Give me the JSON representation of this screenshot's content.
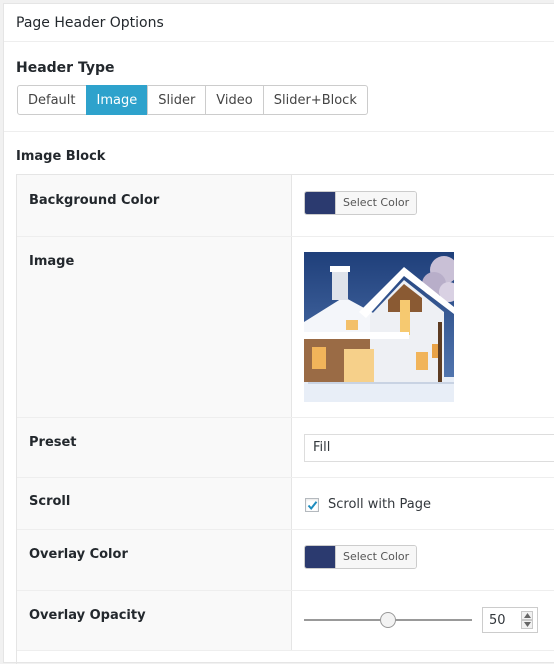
{
  "panel": {
    "title": "Page Header Options"
  },
  "header_type": {
    "label": "Header Type",
    "tabs": [
      "Default",
      "Image",
      "Slider",
      "Video",
      "Slider+Block"
    ],
    "active": "Image"
  },
  "image_block": {
    "label": "Image Block",
    "background_color": {
      "label": "Background Color",
      "button_label": "Select Color",
      "color": "#2b3a6f"
    },
    "image": {
      "label": "Image",
      "icon": "house-thumbnail-image"
    },
    "preset": {
      "label": "Preset",
      "value": "Fill"
    },
    "scroll": {
      "label": "Scroll",
      "checkbox_label": "Scroll with Page",
      "checked": true
    },
    "overlay_color": {
      "label": "Overlay Color",
      "button_label": "Select Color",
      "color": "#2b3a6f"
    },
    "overlay_opacity": {
      "label": "Overlay Opacity",
      "value": "50",
      "fraction": 0.5
    }
  },
  "colors": {
    "accent": "#2ea2cc",
    "swatch": "#2b3a6f"
  }
}
